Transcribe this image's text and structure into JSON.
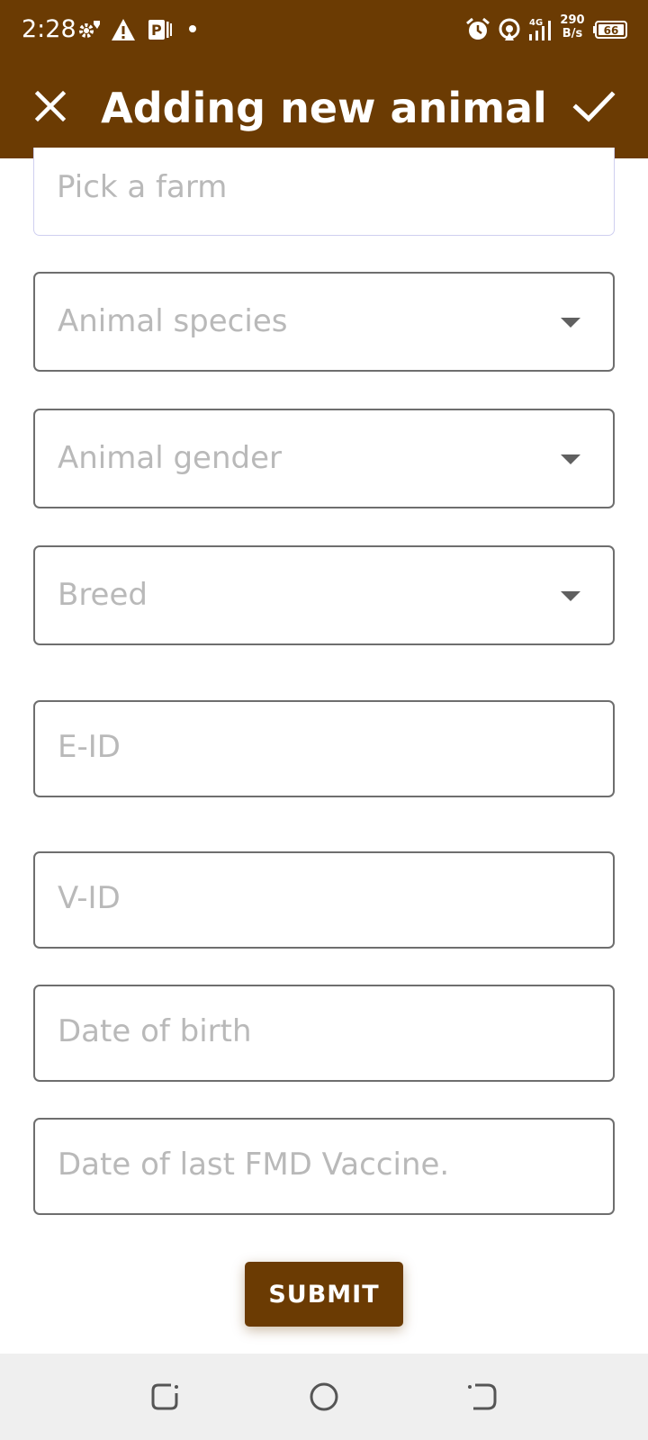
{
  "status_bar": {
    "time": "2:28",
    "net_speed_value": "290",
    "net_speed_unit": "B/s",
    "network_type": "4G",
    "battery": "66",
    "icons": [
      "settings-icon",
      "warning-icon",
      "parking-icon",
      "dot-icon",
      "alarm-icon",
      "hotspot-icon",
      "signal-icon",
      "battery-icon"
    ]
  },
  "header": {
    "title": "Adding new animal",
    "close_icon": "close-icon",
    "confirm_icon": "check-icon",
    "background": "#6b3b03"
  },
  "form": {
    "farm_placeholder": "Pick a farm",
    "species_placeholder": "Animal species",
    "gender_placeholder": "Animal gender",
    "breed_placeholder": "Breed",
    "eid_placeholder": "E-ID",
    "vid_placeholder": "V-ID",
    "dob_placeholder": "Date of birth",
    "fmd_placeholder": "Date of last FMD Vaccine.",
    "submit_label": "SUBMIT"
  },
  "nav_bar": {
    "icons": [
      "recents-icon",
      "home-icon",
      "back-icon"
    ]
  }
}
